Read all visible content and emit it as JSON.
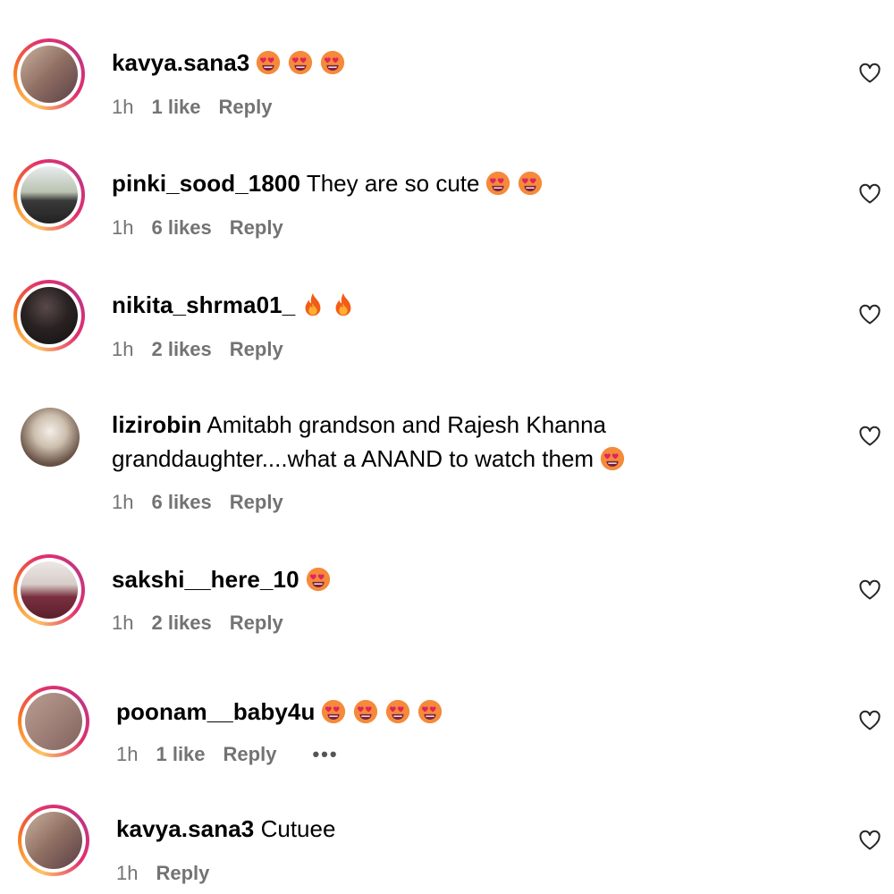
{
  "comments": [
    {
      "username": "kavya.sana3",
      "text": "",
      "emojis": [
        "heart-eyes",
        "heart-eyes",
        "heart-eyes"
      ],
      "time": "1h",
      "likes": "1 like",
      "reply": "Reply"
    },
    {
      "username": "pinki_sood_1800",
      "text": "They are so cute",
      "emojis": [
        "heart-eyes",
        "heart-eyes"
      ],
      "time": "1h",
      "likes": "6 likes",
      "reply": "Reply"
    },
    {
      "username": "nikita_shrma01_",
      "text": "",
      "emojis": [
        "fire",
        "fire"
      ],
      "time": "1h",
      "likes": "2 likes",
      "reply": "Reply"
    },
    {
      "username": "lizirobin",
      "text": "Amitabh grandson and Rajesh Khanna granddaughter....what a ANAND to watch them",
      "emojis": [
        "heart-eyes"
      ],
      "time": "1h",
      "likes": "6 likes",
      "reply": "Reply"
    },
    {
      "username": "sakshi__here_10",
      "text": "",
      "emojis": [
        "heart-eyes"
      ],
      "time": "1h",
      "likes": "2 likes",
      "reply": "Reply"
    },
    {
      "username": "poonam__baby4u",
      "text": "",
      "emojis": [
        "heart-eyes",
        "heart-eyes",
        "heart-eyes",
        "heart-eyes"
      ],
      "time": "1h",
      "likes": "1 like",
      "reply": "Reply",
      "more": "•••"
    },
    {
      "username": "kavya.sana3",
      "text": "Cutuee",
      "emojis": [],
      "time": "1h",
      "likes": "",
      "reply": "Reply"
    }
  ],
  "colors": {
    "meta_text": "#737373",
    "story_ring": [
      "#fdc468",
      "#fa7e1e",
      "#e1306c",
      "#c13584"
    ],
    "emoji_face": "#f58a3a",
    "emoji_heart": "#e0245e"
  },
  "icons": {
    "like": "heart-outline-icon",
    "heart_eyes": "heart-eyes-emoji-icon",
    "fire": "fire-emoji-icon"
  }
}
